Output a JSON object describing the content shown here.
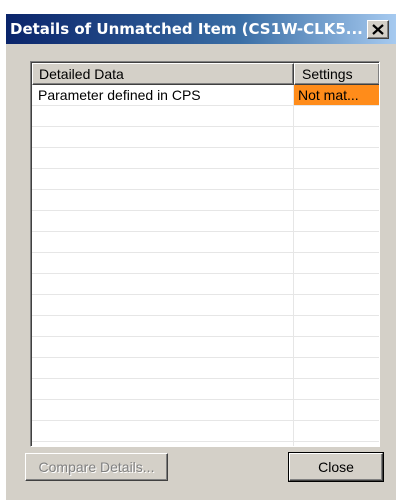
{
  "window": {
    "title": "Details of Unmatched Item (CS1W-CLK5...",
    "close_glyph": "✕"
  },
  "table": {
    "columns": [
      "Detailed Data",
      "Settings"
    ],
    "rows": [
      {
        "detail": "Parameter defined in CPS",
        "setting": "Not mat...",
        "mismatch": true
      },
      {
        "detail": "",
        "setting": "",
        "mismatch": false
      },
      {
        "detail": "",
        "setting": "",
        "mismatch": false
      },
      {
        "detail": "",
        "setting": "",
        "mismatch": false
      },
      {
        "detail": "",
        "setting": "",
        "mismatch": false
      },
      {
        "detail": "",
        "setting": "",
        "mismatch": false
      },
      {
        "detail": "",
        "setting": "",
        "mismatch": false
      },
      {
        "detail": "",
        "setting": "",
        "mismatch": false
      },
      {
        "detail": "",
        "setting": "",
        "mismatch": false
      },
      {
        "detail": "",
        "setting": "",
        "mismatch": false
      },
      {
        "detail": "",
        "setting": "",
        "mismatch": false
      },
      {
        "detail": "",
        "setting": "",
        "mismatch": false
      },
      {
        "detail": "",
        "setting": "",
        "mismatch": false
      },
      {
        "detail": "",
        "setting": "",
        "mismatch": false
      },
      {
        "detail": "",
        "setting": "",
        "mismatch": false
      },
      {
        "detail": "",
        "setting": "",
        "mismatch": false
      },
      {
        "detail": "",
        "setting": "",
        "mismatch": false
      },
      {
        "detail": "",
        "setting": "",
        "mismatch": false
      }
    ]
  },
  "buttons": {
    "compare_label": "Compare Details...",
    "compare_enabled": false,
    "close_label": "Close"
  },
  "colors": {
    "mismatch_highlight": "#ff8c1a",
    "titlebar_start": "#0a246a",
    "titlebar_end": "#a6caf0",
    "dialog_face": "#d4d0c8"
  }
}
